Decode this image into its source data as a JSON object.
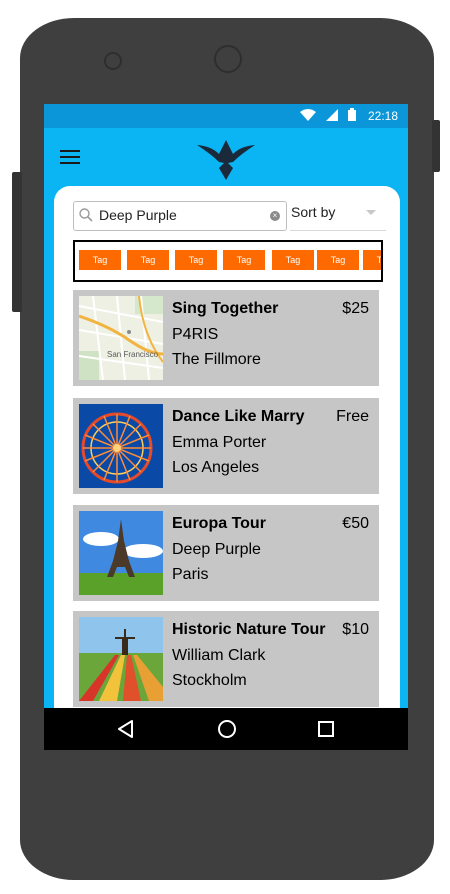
{
  "status_bar": {
    "time": "22:18",
    "icons": [
      "wifi-icon",
      "signal-icon",
      "battery-icon"
    ]
  },
  "app_bar": {
    "menu_icon": "hamburger-menu-icon",
    "logo_icon": "bird-logo-icon"
  },
  "search": {
    "value": "Deep Purple",
    "placeholder": ""
  },
  "sort": {
    "label": "Sort by"
  },
  "tags": [
    "Tag",
    "Tag",
    "Tag",
    "Tag",
    "Tag",
    "Tag",
    "Tag"
  ],
  "events": [
    {
      "title": "Sing Together",
      "price": "$25",
      "artist": "P4RIS",
      "place": "The Fillmore",
      "image": "map-thumbnail"
    },
    {
      "title": "Dance Like Marry",
      "price": "Free",
      "artist": "Emma Porter",
      "place": "Los Angeles",
      "image": "ferris-wheel-thumbnail"
    },
    {
      "title": "Europa Tour",
      "price": "€50",
      "artist": "Deep Purple",
      "place": "Paris",
      "image": "eiffel-tower-thumbnail"
    },
    {
      "title": "Historic Nature Tour",
      "price": "$10",
      "artist": "William Clark",
      "place": "Stockholm",
      "image": "tulip-field-thumbnail"
    }
  ],
  "nav": [
    "back-icon",
    "home-icon",
    "recents-icon"
  ],
  "colors": {
    "status_bar": "#0a96d8",
    "app_bar": "#0bb4f3",
    "tag": "#ff6a00",
    "event_card": "#c6c6c6",
    "phone": "#3f3f3f"
  }
}
